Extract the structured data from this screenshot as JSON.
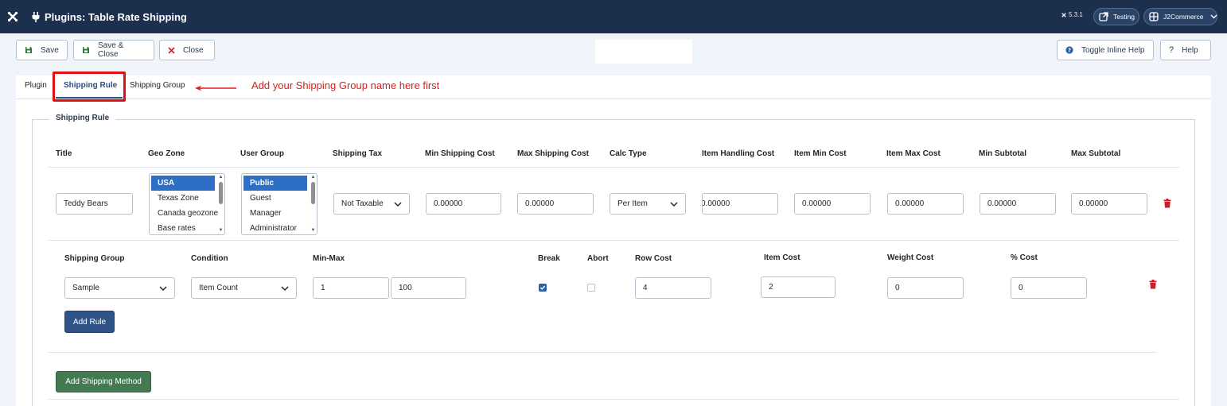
{
  "header": {
    "title": "Plugins: Table Rate Shipping",
    "version": "5.3.1",
    "site_button": "Testing",
    "user_button": "J2Commerce"
  },
  "toolbar": {
    "save": "Save",
    "save_close": "Save & Close",
    "close": "Close",
    "toggle_help": "Toggle Inline Help",
    "help": "Help"
  },
  "tabs": [
    {
      "label": "Plugin",
      "active": false
    },
    {
      "label": "Shipping Rule",
      "active": true
    },
    {
      "label": "Shipping Group",
      "active": false
    }
  ],
  "annotation": "Add your Shipping Group name here first",
  "fieldset": {
    "legend": "Shipping Rule",
    "columns": [
      "Title",
      "Geo Zone",
      "User Group",
      "Shipping Tax",
      "Min Shipping Cost",
      "Max Shipping Cost",
      "Calc Type",
      "Item Handling Cost",
      "Item Min Cost",
      "Item Max Cost",
      "Min Subtotal",
      "Max Subtotal"
    ],
    "rule": {
      "title": "Teddy Bears",
      "geo_zones": [
        "USA",
        "Texas Zone",
        "Canada geozone",
        "Base rates"
      ],
      "geo_zone_selected": "USA",
      "user_groups": [
        "Public",
        "Guest",
        "Manager",
        "Administrator"
      ],
      "user_group_selected": "Public",
      "shipping_tax": "Not Taxable",
      "min_shipping_cost": "0.00000",
      "max_shipping_cost": "0.00000",
      "calc_type": "Per Item",
      "item_handling_cost": "0.00000",
      "item_min_cost": "0.00000",
      "item_max_cost": "0.00000",
      "min_subtotal": "0.00000",
      "max_subtotal": "0.00000"
    },
    "subrule_columns": [
      "Shipping Group",
      "Condition",
      "Min-Max",
      "Break",
      "Abort",
      "Row Cost",
      "Item Cost",
      "Weight Cost",
      "% Cost"
    ],
    "subrule": {
      "shipping_group": "Sample",
      "condition": "Item Count",
      "min": "1",
      "max": "100",
      "break_checked": true,
      "abort_checked": false,
      "row_cost": "4",
      "item_cost": "2",
      "weight_cost": "0",
      "percent_cost": "0"
    },
    "add_rule": "Add Rule",
    "add_method": "Add Shipping Method"
  },
  "colors": {
    "header_bg": "#1c2f4c",
    "accent": "#2a4f82",
    "selected_option": "#2d6ec7",
    "add_rule": "#2e5487",
    "add_method": "#447a52",
    "delete": "#c8202a",
    "annotation": "#e01c1c"
  },
  "icons": [
    "joomla-icon",
    "plug-icon",
    "external-link-icon",
    "user-menu-icon",
    "chevron-down-icon",
    "save-icon",
    "close-x-icon",
    "question-circle-icon",
    "question-icon",
    "trash-icon",
    "check-icon",
    "arrow-left-icon"
  ]
}
